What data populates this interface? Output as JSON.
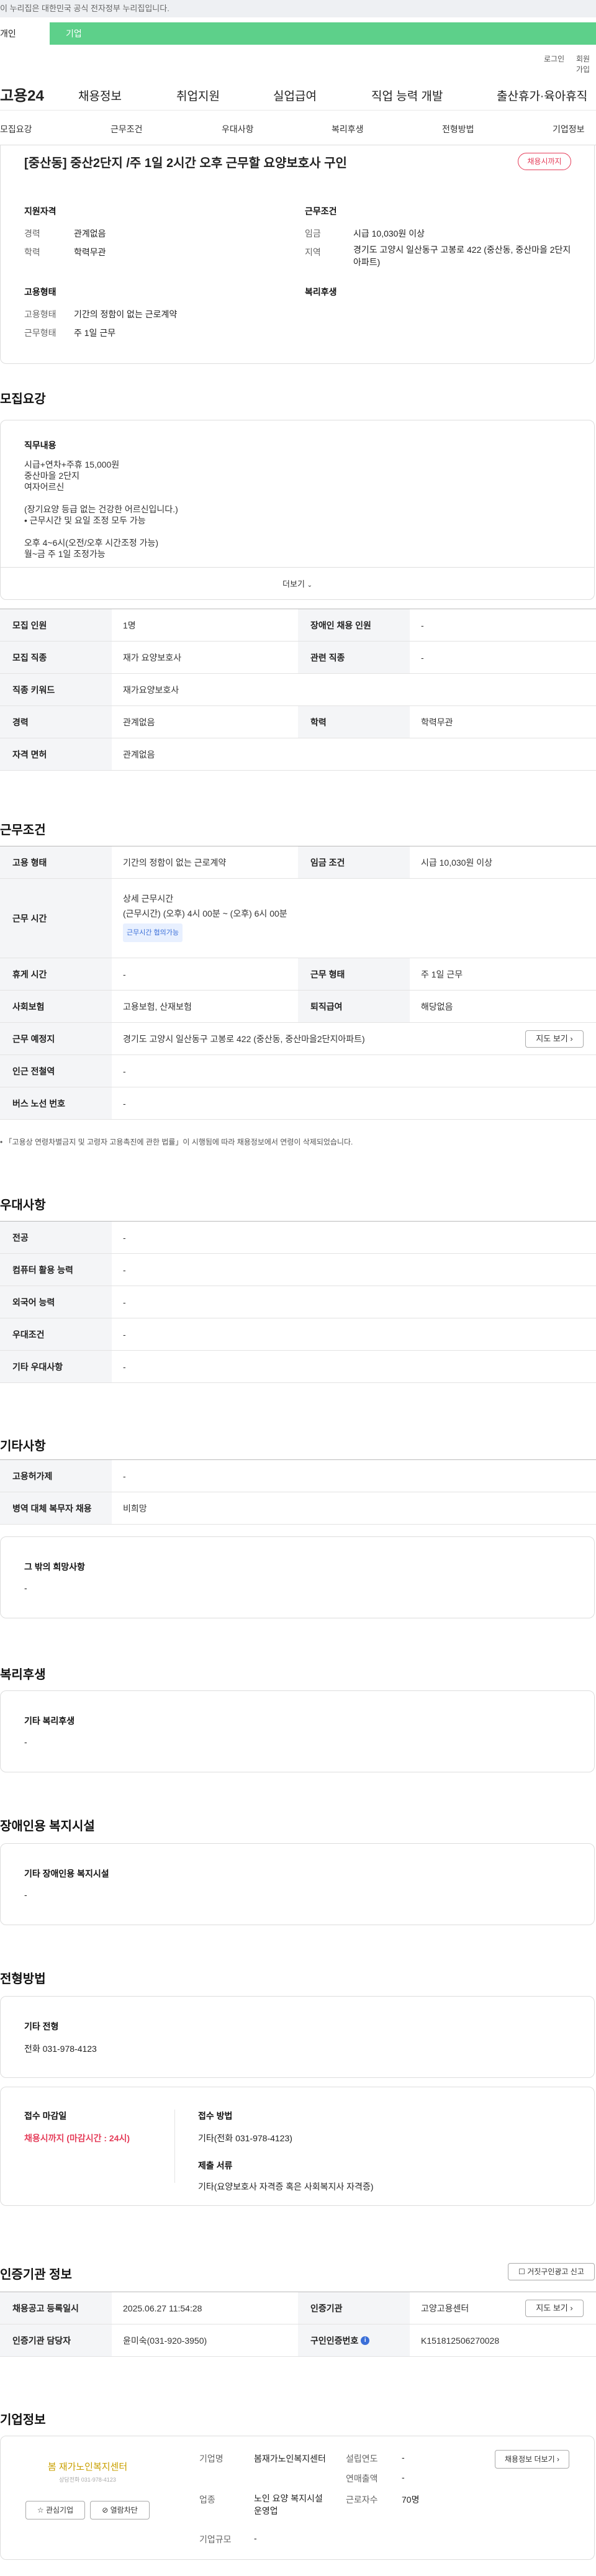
{
  "topbar": {
    "text": "이 누리집은 대한민국 공식 전자정부 누리집입니다."
  },
  "user_tabs": {
    "individual": "개인",
    "enterprise": "기업"
  },
  "login": {
    "login": "로그인",
    "signup": "회원가입"
  },
  "gnb": {
    "logo": "고용24",
    "menus": [
      "채용정보",
      "취업지원",
      "실업급여",
      "직업 능력 개발",
      "출산휴가·육아휴직"
    ]
  },
  "snb": [
    "모집요강",
    "근무조건",
    "우대사항",
    "복리후생",
    "전형방법",
    "기업정보"
  ],
  "summary": {
    "title": "[중산동] 중산2단지 /주 1일 2시간 오후 근무할 요양보호사 구인",
    "status_badge": "채용시까지",
    "qualification_title": "지원자격",
    "q_career_label": "경력",
    "q_career_value": "관계없음",
    "q_edu_label": "학력",
    "q_edu_value": "학력무관",
    "conditions_title": "근무조건",
    "c_wage_label": "임금",
    "c_wage_value": "시급 10,030원 이상",
    "c_region_label": "지역",
    "c_region_value": "경기도 고양시 일산동구 고봉로 422 (중산동, 중산마을 2단지아파트)",
    "employ_title": "고용형태",
    "e_type_label": "고용형태",
    "e_type_value": "기간의 정함이 없는 근로계약",
    "e_shift_label": "근무형태",
    "e_shift_value": "주 1일 근무",
    "welfare_title": "복리후생"
  },
  "recruit": {
    "section_title": "모집요강",
    "duty_title": "직무내용",
    "duty_lines": [
      "시급+연차+주휴 15,000원",
      "중산마을 2단지",
      "여자어르신",
      "",
      "(장기요양 등급 없는 건강한 어르신입니다.)",
      "• 근무시간 및 요일 조정 모두 가능",
      "",
      "오후 4~6시(오전/오후 시간조정 가능)",
      "월~금 주 1일 조정가능"
    ],
    "more_label": "더보기",
    "rows": [
      {
        "l1": "모집 인원",
        "v1": "1명",
        "l2": "장애인 채용 인원",
        "v2": "-"
      },
      {
        "l1": "모집 직종",
        "v1": "재가 요양보호사",
        "l2": "관련 직종",
        "v2": "-"
      },
      {
        "l1": "직종 키워드",
        "v1": "재가요양보호사"
      },
      {
        "l1": "경력",
        "v1": "관계없음",
        "l2": "학력",
        "v2": "학력무관"
      },
      {
        "l1": "자격 면허",
        "v1": "관계없음"
      }
    ]
  },
  "work": {
    "section_title": "근무조건",
    "r1": {
      "l1": "고용 형태",
      "v1": "기간의 정함이 없는 근로계약",
      "l2": "임금 조건",
      "v2": "시급 10,030원 이상"
    },
    "hours": {
      "label": "근무 시간",
      "title": "상세 근무시간",
      "text": "(근무시간) (오후) 4시 00분 ~ (오후) 6시 00분",
      "tag": "근무시간 협의가능"
    },
    "r3": {
      "l1": "휴게 시간",
      "v1": "-",
      "l2": "근무 형태",
      "v2": "주 1일 근무"
    },
    "r4": {
      "l1": "사회보험",
      "v1": "고용보험, 산재보험",
      "l2": "퇴직급여",
      "v2": "해당없음"
    },
    "r5": {
      "l1": "근무 예정지",
      "v1": "경기도 고양시 일산동구 고봉로 422 (중산동, 중산마을2단지아파트)",
      "map": "지도 보기"
    },
    "r6": {
      "l1": "인근 전철역",
      "v1": "-"
    },
    "r7": {
      "l1": "버스 노선 번호",
      "v1": "-"
    },
    "note": "• 「고용상 연령차별금지 및 고령자 고용촉진에 관한 법률」이 시행됨에 따라 채용정보에서 연령이 삭제되었습니다."
  },
  "pref": {
    "section_title": "우대사항",
    "rows": [
      {
        "l": "전공",
        "v": "-"
      },
      {
        "l": "컴퓨터 활용 능력",
        "v": "-"
      },
      {
        "l": "외국어 능력",
        "v": "-"
      },
      {
        "l": "우대조건",
        "v": "-"
      },
      {
        "l": "기타 우대사항",
        "v": "-"
      }
    ]
  },
  "etc": {
    "section_title": "기타사항",
    "rows": [
      {
        "l": "고용허가제",
        "v": "-"
      },
      {
        "l": "병역 대체 복무자 채용",
        "v": "비희망"
      }
    ],
    "box_title": "그 밖의 희망사항",
    "box_value": "-"
  },
  "welfare": {
    "section_title": "복리후생",
    "box_title": "기타 복리후생",
    "box_value": "-"
  },
  "facility": {
    "section_title": "장애인용 복지시설",
    "box_title": "기타 장애인용 복지시설",
    "box_value": "-"
  },
  "screening": {
    "section_title": "전형방법",
    "box_title": "기타 전형",
    "box_value": "전화 031-978-4123",
    "deadline_title": "접수 마감일",
    "deadline_value": "채용시까지 (마감시간 : 24시)",
    "method_title": "접수 방법",
    "method_value": "기타(전화 031-978-4123)",
    "docs_title": "제출 서류",
    "docs_value": "기타(요양보호사 자격증 혹은 사회복지사 자격증)"
  },
  "auth": {
    "section_title": "인증기관 정보",
    "report_btn": "거짓구인광고 신고",
    "r1": {
      "l1": "채용공고 등록일시",
      "v1": "2025.06.27 11:54:28",
      "l2": "인증기관",
      "v2": "고양고용센터",
      "btn": "지도 보기"
    },
    "r2": {
      "l1": "인증기관 담당자",
      "v1": "윤미숙(031-920-3950)",
      "l2": "구인인증번호",
      "v2": "K151812506270028"
    }
  },
  "company": {
    "section_title": "기업정보",
    "logo_text": "봄 재가노인복지센터",
    "logo_sub": "상담전화 031-978-4123",
    "fav_btn": "관심기업",
    "block_btn": "열람차단",
    "name_label": "기업명",
    "name_value": "봄재가노인복지센터",
    "biz_label": "업종",
    "biz_value": "노인 요양 복지시설 운영업",
    "size_label": "기업규모",
    "size_value": "-",
    "year_label": "설립연도",
    "year_value": "-",
    "sales_label": "연매출액",
    "sales_value": "-",
    "emp_label": "근로자수",
    "emp_value": "70명",
    "jobs_btn": "채용정보 더보기"
  },
  "colors": {
    "accent": "#3b6fd8",
    "deadline": "#e53e5a",
    "tab_green": "#5dd08a"
  }
}
